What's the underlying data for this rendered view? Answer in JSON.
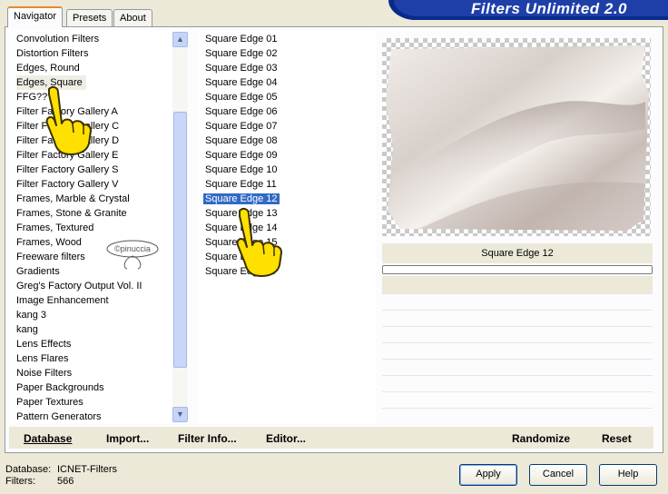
{
  "banner": {
    "title": "Filters Unlimited 2.0"
  },
  "tabs": [
    {
      "label": "Navigator",
      "active": true
    },
    {
      "label": "Presets"
    },
    {
      "label": "About"
    }
  ],
  "categories": [
    "Convolution Filters",
    "Distortion Filters",
    "Edges, Round",
    "Edges, Square",
    "FFG???",
    "Filter Factory Gallery A",
    "Filter Factory Gallery C",
    "Filter Factory Gallery D",
    "Filter Factory Gallery E",
    "Filter Factory Gallery S",
    "Filter Factory Gallery V",
    "Frames, Marble & Crystal",
    "Frames, Stone & Granite",
    "Frames, Textured",
    "Frames, Wood",
    "Freeware filters",
    "Gradients",
    "Greg's Factory Output Vol. II",
    "Image Enhancement",
    "kang 3",
    "kang",
    "Lens Effects",
    "Lens Flares",
    "Noise Filters",
    "Paper Backgrounds",
    "Paper Textures",
    "Pattern Generators"
  ],
  "filters": [
    "Square Edge 01",
    "Square Edge 02",
    "Square Edge 03",
    "Square Edge 04",
    "Square Edge 05",
    "Square Edge 06",
    "Square Edge 07",
    "Square Edge 08",
    "Square Edge 09",
    "Square Edge 10",
    "Square Edge 11",
    "Square Edge 12",
    "Square Edge 13",
    "Square Edge 14",
    "Square Edge 15",
    "Square Edge 16",
    "Square Edge 17"
  ],
  "selected_filter": "Square Edge 12",
  "watermark": "©pinuccia",
  "bottom_links": {
    "database": "Database",
    "import": "Import...",
    "filter_info": "Filter Info...",
    "editor": "Editor...",
    "randomize": "Randomize",
    "reset": "Reset"
  },
  "status": {
    "database_label": "Database:",
    "database_value": "ICNET-Filters",
    "filters_label": "Filters:",
    "filters_value": "566"
  },
  "buttons": {
    "apply": "Apply",
    "cancel": "Cancel",
    "help": "Help"
  },
  "colors": {
    "selection": "#316ac5",
    "banner": "#0a2a8a",
    "hand": "#ffe000"
  }
}
